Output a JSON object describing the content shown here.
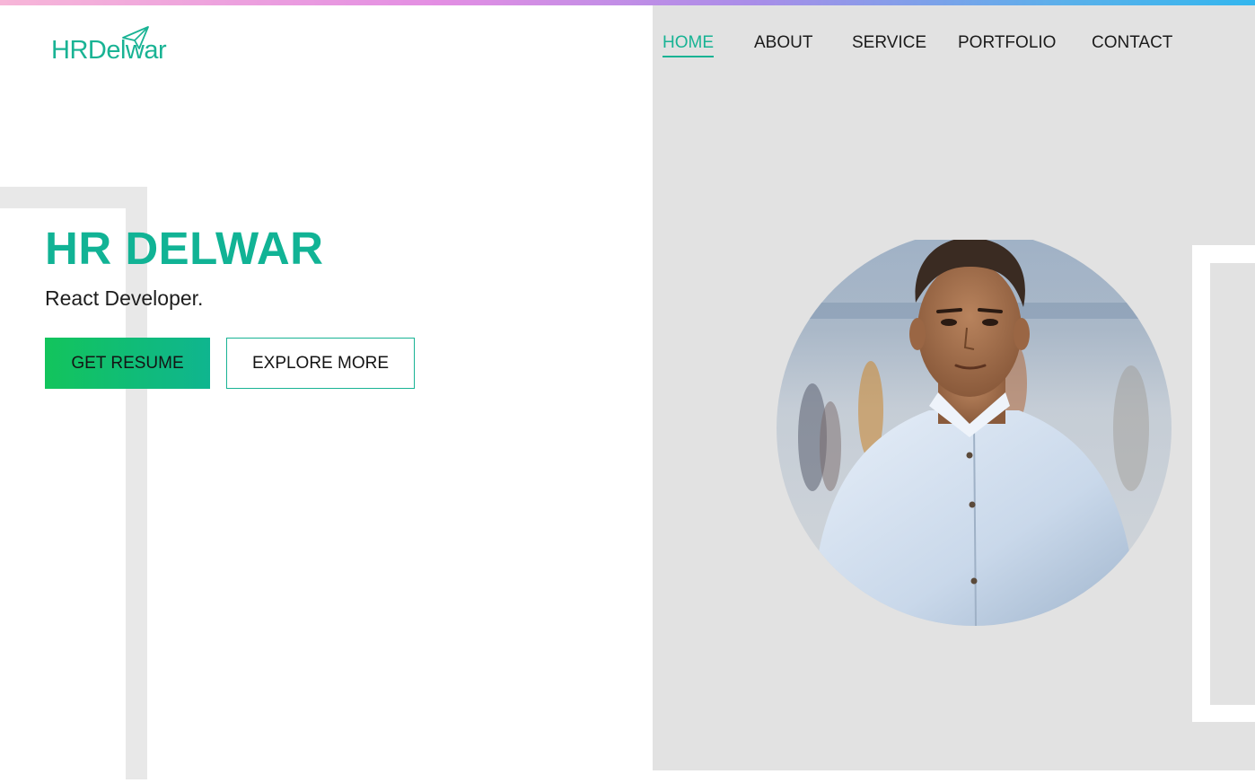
{
  "logo": {
    "text": "HRDelwar",
    "icon": "paper-plane-icon"
  },
  "nav": {
    "items": [
      {
        "label": "HOME",
        "active": true
      },
      {
        "label": "ABOUT",
        "active": false
      },
      {
        "label": "SERVICE",
        "active": false
      },
      {
        "label": "PORTFOLIO",
        "active": false
      },
      {
        "label": "CONTACT",
        "active": false
      }
    ]
  },
  "hero": {
    "name": "HR DELWAR",
    "role": "React Developer.",
    "primary_button": "GET RESUME",
    "secondary_button": "EXPLORE MORE"
  },
  "profile_photo": {
    "shape": "circle"
  },
  "colors": {
    "accent": "#18b394",
    "button_gradient_start": "#12c45c",
    "button_gradient_end": "#0fb58f",
    "right_panel": "#e2e2e2",
    "top_gradient": [
      "#f7b6d8",
      "#e38ee3",
      "#a98de8",
      "#33b6ee"
    ]
  }
}
